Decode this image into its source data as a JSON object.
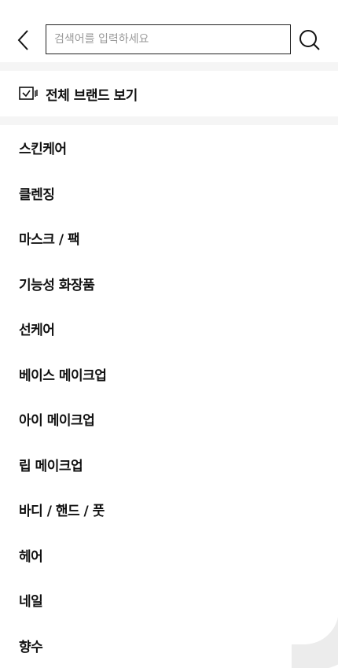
{
  "header": {
    "search_placeholder": "검색어를 입력하세요",
    "back_icon": "chevron-left-icon",
    "search_icon": "search-icon"
  },
  "all_brands": {
    "label": "전체 브랜드 보기",
    "icon": "brand-check-icon"
  },
  "categories": [
    {
      "label": "스킨케어"
    },
    {
      "label": "클렌징"
    },
    {
      "label": "마스크 / 팩"
    },
    {
      "label": "기능성 화장품"
    },
    {
      "label": "선케어"
    },
    {
      "label": "베이스 메이크업"
    },
    {
      "label": "아이 메이크업"
    },
    {
      "label": "립 메이크업"
    },
    {
      "label": "바디 / 핸드 / 풋"
    },
    {
      "label": "헤어"
    },
    {
      "label": "네일"
    },
    {
      "label": "향수"
    }
  ],
  "colors": {
    "text": "#111111",
    "divider": "#f5f5f5",
    "placeholder": "#9a9a9a"
  }
}
